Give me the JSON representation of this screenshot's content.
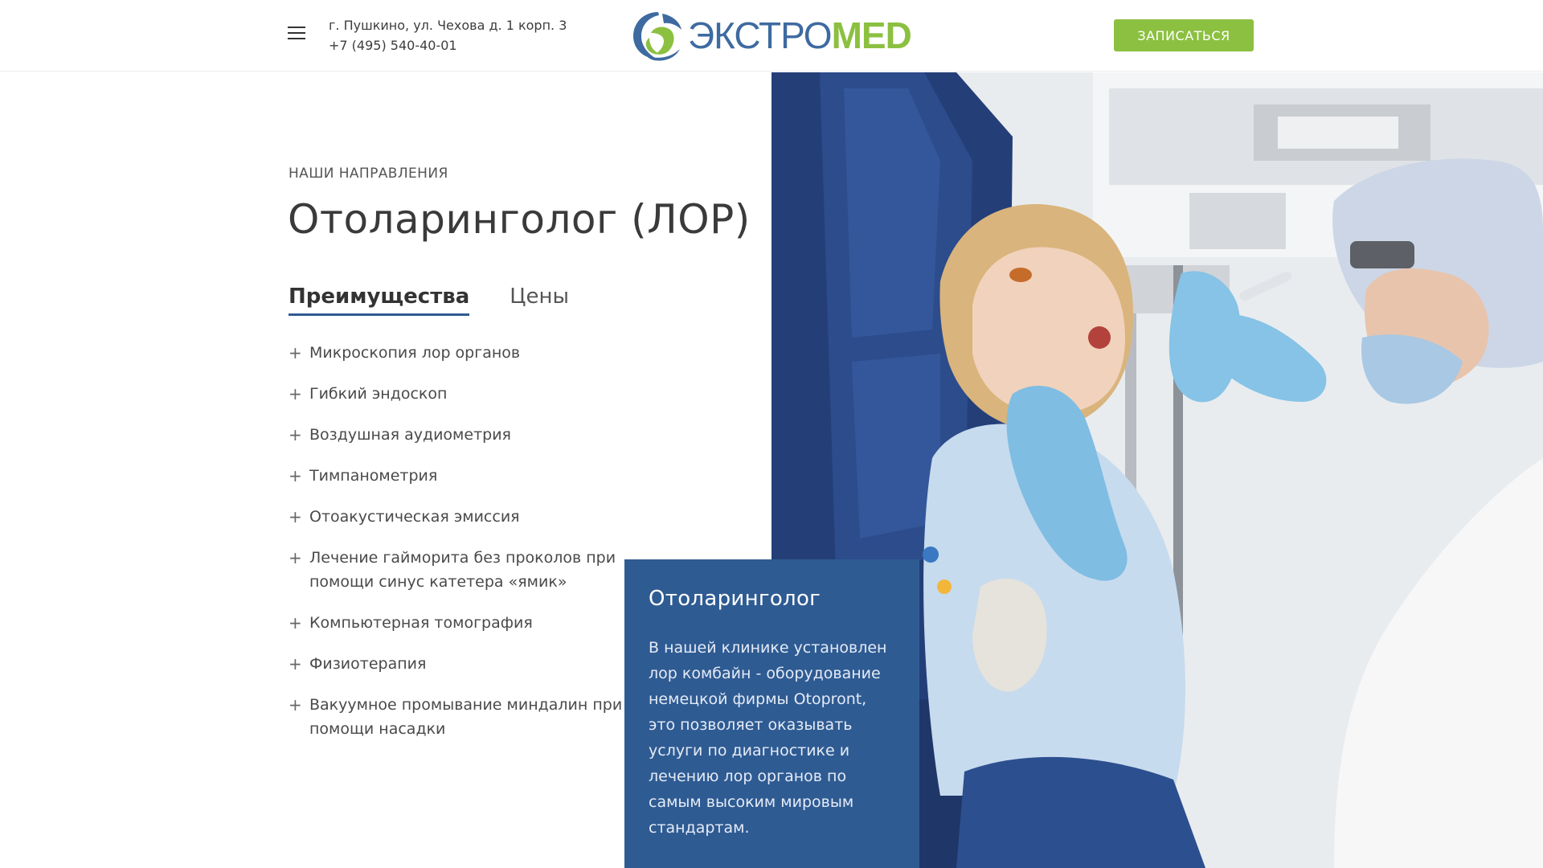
{
  "header": {
    "address": "г. Пушкино, ул. Чехова д. 1 корп. 3",
    "phone": "+7 (495) 540-40-01",
    "logo_part1": "ЭКСТРО",
    "logo_part2": "MED",
    "cta_label": "ЗАПИСАТЬСЯ"
  },
  "main": {
    "eyebrow": "НАШИ НАПРАВЛЕНИЯ",
    "title": "Отоларинголог (ЛОР)",
    "tabs": [
      {
        "label": "Преимущества"
      },
      {
        "label": "Цены"
      }
    ],
    "features": [
      {
        "text": "Микроскопия лор органов"
      },
      {
        "text": "Гибкий эндоскоп"
      },
      {
        "text": "Воздушная аудиометрия"
      },
      {
        "text": "Тимпанометрия"
      },
      {
        "text": "Отоакустическая эмиссия"
      },
      {
        "text": "Лечение гайморита без проколов при помощи синус катетера «ямик»"
      },
      {
        "text": "Компьютерная томография"
      },
      {
        "text": "Физиотерапия"
      },
      {
        "text": "Вакуумное промывание миндалин при помощи насадки"
      }
    ]
  },
  "card": {
    "title": "Отоларинголог",
    "text": "В нашей клинике установлен лор комбайн -  оборудование немецкой фирмы Otopront, это позволяет оказывать услуги по диагностике и лечению лор органов   по самым высоким мировым стандартам."
  },
  "colors": {
    "accent_green": "#8cc040",
    "brand_blue": "#2f5b93",
    "logo_blue": "#3e6aa0"
  },
  "icons": {
    "menu": "menu-icon",
    "plus": "plus-icon"
  }
}
